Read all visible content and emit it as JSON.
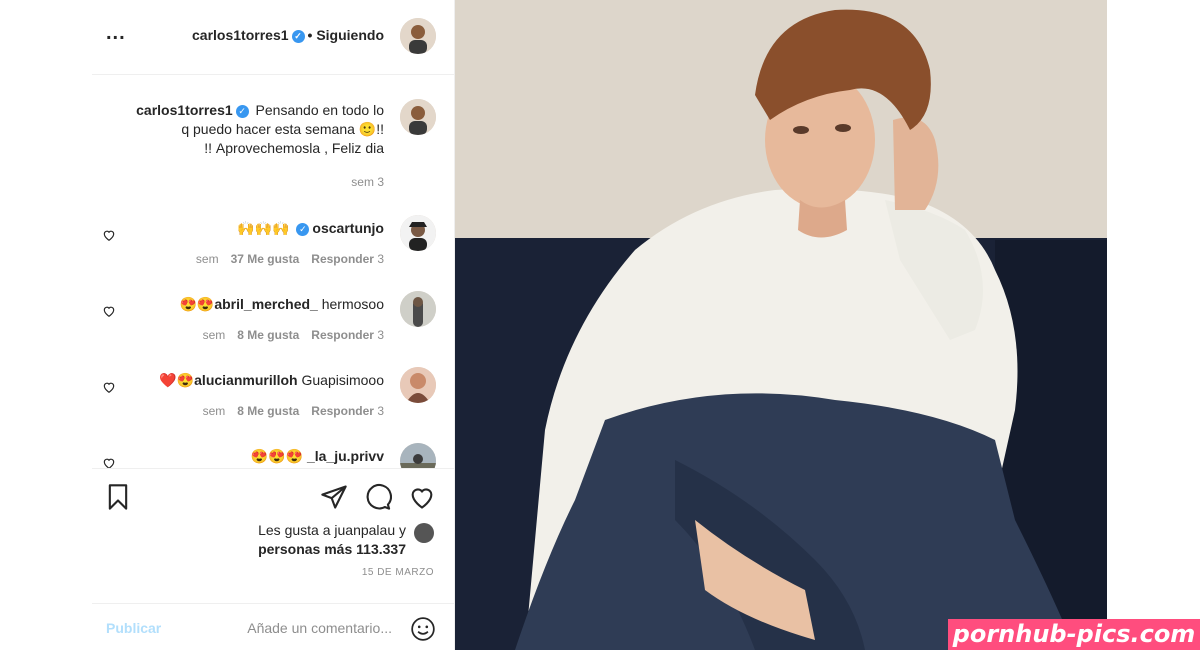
{
  "header": {
    "username": "carlos1torres1",
    "separator": "•",
    "follow_status": "Siguiendo",
    "more_icon": "ellipsis-icon",
    "more_label": "..."
  },
  "caption": {
    "username": "carlos1torres1",
    "text": "Pensando en todo lo q puedo hacer esta semana 🙂!! Aprovechemosla , Feliz dia !!",
    "time": "3 sem"
  },
  "comments": [
    {
      "username": "oscartunjo",
      "text": "🙌🙌🙌",
      "verified": true,
      "time": "3 sem",
      "likes": "37 Me gusta",
      "reply": "Responder"
    },
    {
      "username": "abril_merched_",
      "text": "hermosoo😍😍",
      "verified": false,
      "time": "3 sem",
      "likes": "8 Me gusta",
      "reply": "Responder"
    },
    {
      "username": "alucianmurilloh",
      "text": "Guapisimooo😍❤️",
      "verified": false,
      "time": "3 sem",
      "likes": "8 Me gusta",
      "reply": "Responder"
    },
    {
      "username": "la_ju.privv_",
      "text": "😍😍😍",
      "verified": false,
      "time": "",
      "likes": "",
      "reply": ""
    }
  ],
  "actions": {
    "icons": [
      "heart-icon",
      "comment-icon",
      "share-icon",
      "bookmark-icon"
    ]
  },
  "likes": {
    "line1": "Les gusta a juanpalau y",
    "line2": "113.337 personas más"
  },
  "date": "15 DE MARZO",
  "add_comment": {
    "placeholder": "Añade un comentario...",
    "publish": "Publicar"
  },
  "watermark": "pornhub-pics.com",
  "colors": {
    "link_blue": "#3897f0",
    "publish_disabled": "#b2dffc",
    "muted": "#8e8e8e",
    "watermark_bg": "#ff4d7e"
  }
}
